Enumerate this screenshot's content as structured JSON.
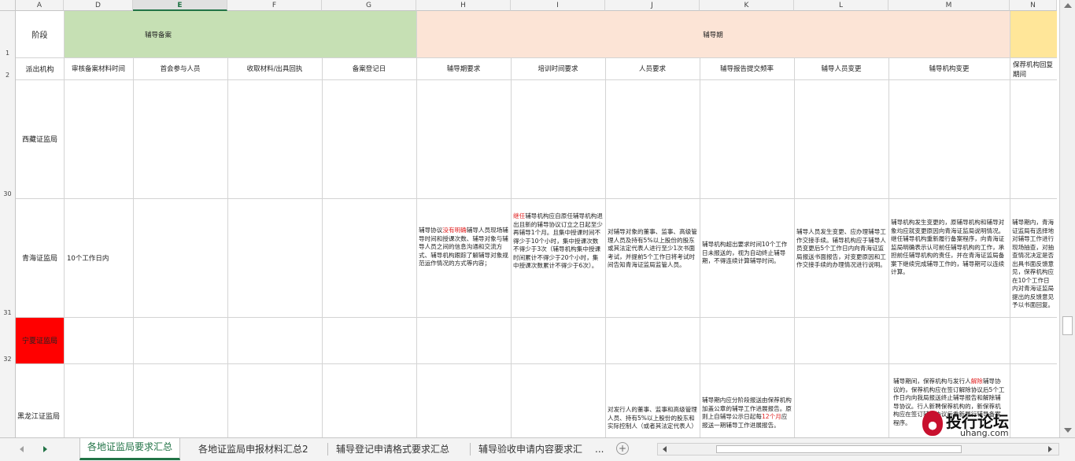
{
  "columns": [
    "A",
    "D",
    "E",
    "F",
    "G",
    "H",
    "I",
    "J",
    "K",
    "L",
    "M",
    "N"
  ],
  "rows": {
    "r1": "1",
    "r2": "2",
    "r30": "30",
    "r31": "31",
    "r32": "32"
  },
  "header": {
    "stage_label": "阶段",
    "group_filing": "辅导备案",
    "group_period": "辅导期",
    "agency_label": "派出机构",
    "col_d": "审核备案材料时间",
    "col_e": "首会参与人员",
    "col_f": "收取材料/出具回执",
    "col_g": "备案登记日",
    "col_h": "辅导期要求",
    "col_i": "培训时间要求",
    "col_j": "人员要求",
    "col_k": "辅导报告提交频率",
    "col_l": "辅导人员变更",
    "col_m": "辅导机构变更",
    "col_n": "保荐机构回复期间"
  },
  "body": {
    "xizang": "西藏证监局",
    "qinghai": "青海证监局",
    "ningxia": "宁夏证监局",
    "heilongjiang": "黑龙江证监局",
    "qh_d": "10个工作日内",
    "qh_h_1": "辅导协议",
    "qh_h_red": "没有明确",
    "qh_h_2": "辅导人员现场辅导时间和授课次数、辅导对象与辅导人员之间的信息沟通和交流方式、辅导机构跟踪了解辅导对象规范运作情况的方式等内容；",
    "qh_i_red": "继任",
    "qh_i": "辅导机构应自原任辅导机构退出且新的辅导协议订立之日起至少再辅导1个月。且集中授课时间不得少于10个小时，集中授课次数不得少于3次（辅导机构集中授课时间累计不得少于20个小时，集中授课次数累计不得少于6次）。",
    "qh_j": "对辅导对象的董事、监事、高级管理人员及持有5%以上股份的股东或其法定代表人进行至少1次书面考试，并提前5个工作日将考试时间告知青海证监局监管人员。",
    "qh_k": "辅导机构超出要求时间10个工作日未报送的，视为自动终止辅导期，不得连续计算辅导时间。",
    "qh_l": "辅导人员发生变更、应办理辅导工作交接手续。辅导机构应于辅导人员变更后5个工作日内向青海证监局报送书面报告，对变更原因和工作交接手续的办理情况进行说明。",
    "qh_m": "辅导机构发生变更的，原辅导机构和辅导对象均应就变更原因向青海证监局说明情况。继任辅导机构重新履行备案程序，向青海证监局明确表示认可前任辅导机构的工作，承担前任辅导机构的责任，并在青海证监局备案下继续完成辅导工作的，辅导期可以连续计算。",
    "qh_n": "辅导期内，青海证监局有选择地对辅导工作进行现场抽查，对抽查情况决定是否出具书面反馈意见，保荐机构应在10个工作日内对青海证监局提出的反馈意见予以书面回复。",
    "hl_j": "对发行人的董事、监事和高级管理人员、持有5%以上股份的股东和实际控制人（或者其法定代表人）",
    "hl_k_1": "辅导期内应分阶段报送由保荐机构加盖公章的辅导工作进展报告。原则上自辅导公示日起每",
    "hl_k_red": "12个月",
    "hl_k_2": "应报送一期辅导工作进展报告。",
    "hl_m_1": "辅导期间，保荐机构与发行人",
    "hl_m_red": "解除",
    "hl_m_2": "辅导协议的，保荐机构应在签订解除协议后5个工作日内向我局报送终止辅导报告和解除辅导协议。行人新聘保荐机构的，新保荐机构应在签订辅导协议后重新履行辅导备案程序。"
  },
  "tabs": [
    "各地证监局要求汇总",
    "各地证监局申报材料汇总2",
    "辅导登记申请格式要求汇总",
    "辅导验收申请内容要求汇"
  ],
  "tab_more": "...",
  "add_sheet": "+",
  "watermark": {
    "brand": "投行论坛",
    "site": "uhang.com"
  },
  "colors": {
    "filing_bg": "#c6e0b4",
    "period_bg": "#fce4d6",
    "n_bg": "#ffe699",
    "ningxia_bg": "#ff0000",
    "active_tab": "#217346"
  }
}
